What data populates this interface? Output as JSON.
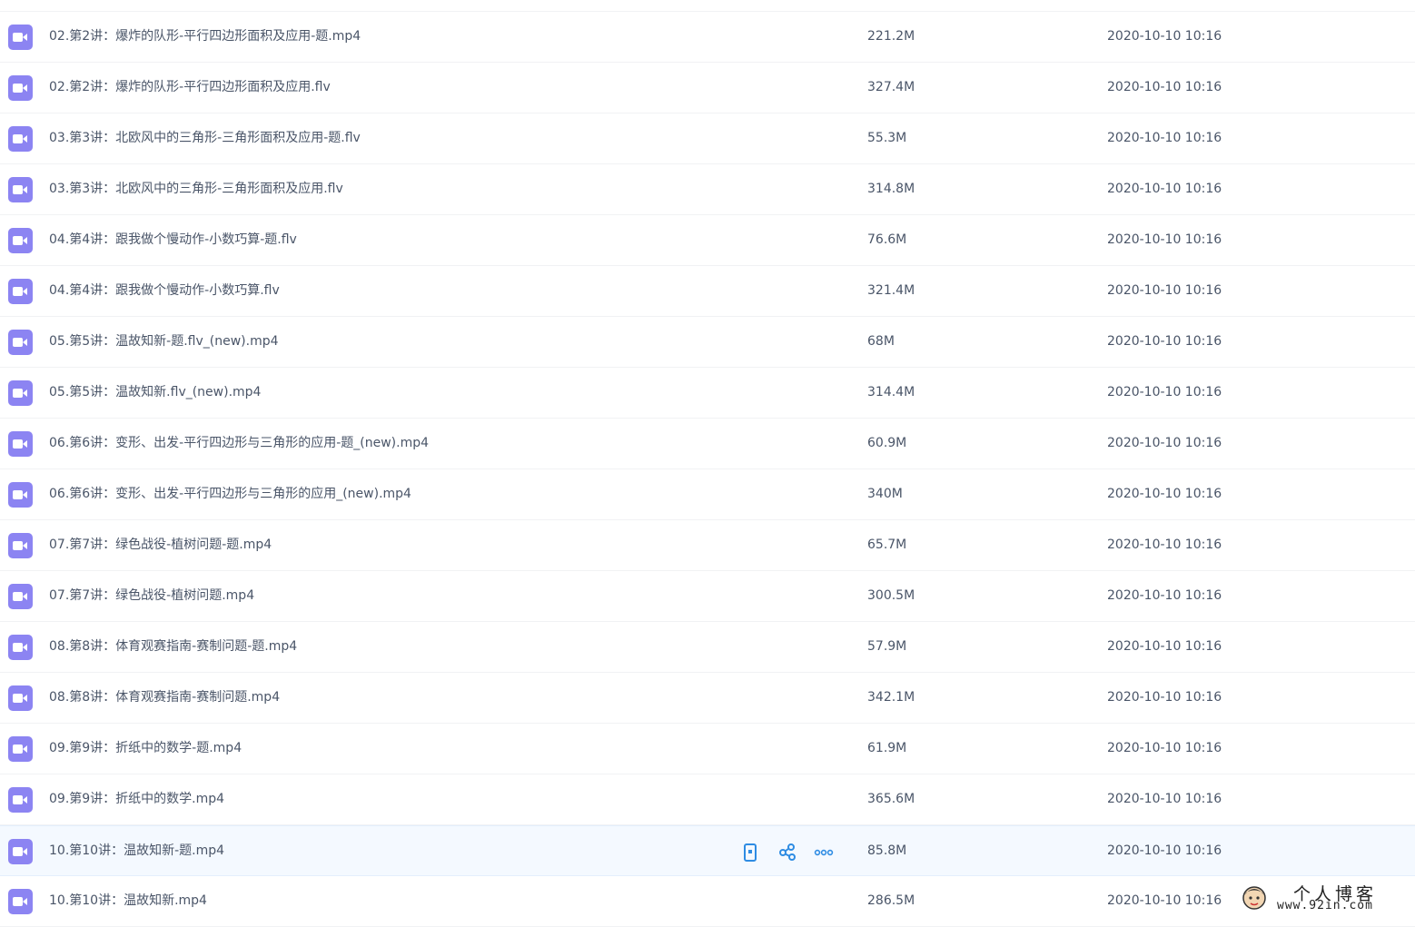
{
  "files": [
    {
      "name": "",
      "size": "",
      "date": ""
    },
    {
      "name": "02.第2讲：爆炸的队形-平行四边形面积及应用-题.mp4",
      "size": "221.2M",
      "date": "2020-10-10 10:16"
    },
    {
      "name": "02.第2讲：爆炸的队形-平行四边形面积及应用.flv",
      "size": "327.4M",
      "date": "2020-10-10 10:16"
    },
    {
      "name": "03.第3讲：北欧风中的三角形-三角形面积及应用-题.flv",
      "size": "55.3M",
      "date": "2020-10-10 10:16"
    },
    {
      "name": "03.第3讲：北欧风中的三角形-三角形面积及应用.flv",
      "size": "314.8M",
      "date": "2020-10-10 10:16"
    },
    {
      "name": "04.第4讲：跟我做个慢动作-小数巧算-题.flv",
      "size": "76.6M",
      "date": "2020-10-10 10:16"
    },
    {
      "name": "04.第4讲：跟我做个慢动作-小数巧算.flv",
      "size": "321.4M",
      "date": "2020-10-10 10:16"
    },
    {
      "name": "05.第5讲：温故知新-题.flv_(new).mp4",
      "size": "68M",
      "date": "2020-10-10 10:16"
    },
    {
      "name": "05.第5讲：温故知新.flv_(new).mp4",
      "size": "314.4M",
      "date": "2020-10-10 10:16"
    },
    {
      "name": "06.第6讲：变形、出发-平行四边形与三角形的应用-题_(new).mp4",
      "size": "60.9M",
      "date": "2020-10-10 10:16"
    },
    {
      "name": "06.第6讲：变形、出发-平行四边形与三角形的应用_(new).mp4",
      "size": "340M",
      "date": "2020-10-10 10:16"
    },
    {
      "name": "07.第7讲：绿色战役-植树问题-题.mp4",
      "size": "65.7M",
      "date": "2020-10-10 10:16"
    },
    {
      "name": "07.第7讲：绿色战役-植树问题.mp4",
      "size": "300.5M",
      "date": "2020-10-10 10:16"
    },
    {
      "name": "08.第8讲：体育观赛指南-赛制问题-题.mp4",
      "size": "57.9M",
      "date": "2020-10-10 10:16"
    },
    {
      "name": "08.第8讲：体育观赛指南-赛制问题.mp4",
      "size": "342.1M",
      "date": "2020-10-10 10:16"
    },
    {
      "name": "09.第9讲：折纸中的数学-题.mp4",
      "size": "61.9M",
      "date": "2020-10-10 10:16"
    },
    {
      "name": "09.第9讲：折纸中的数学.mp4",
      "size": "365.6M",
      "date": "2020-10-10 10:16"
    },
    {
      "name": "10.第10讲：温故知新-题.mp4",
      "size": "85.8M",
      "date": "2020-10-10 10:16"
    },
    {
      "name": "10.第10讲：温故知新.mp4",
      "size": "286.5M",
      "date": "2020-10-10 10:16"
    }
  ],
  "hovered_row": 17,
  "icons": {
    "file": "video-file-icon",
    "actions": [
      "phone-icon",
      "share-icon",
      "more-icon"
    ]
  },
  "colors": {
    "file_icon": "#8c84f2",
    "action": "#2e8ce3",
    "hover_bg": "#f4f9ff"
  },
  "watermark": {
    "title": "个人博客",
    "url": "www.92in.com"
  }
}
